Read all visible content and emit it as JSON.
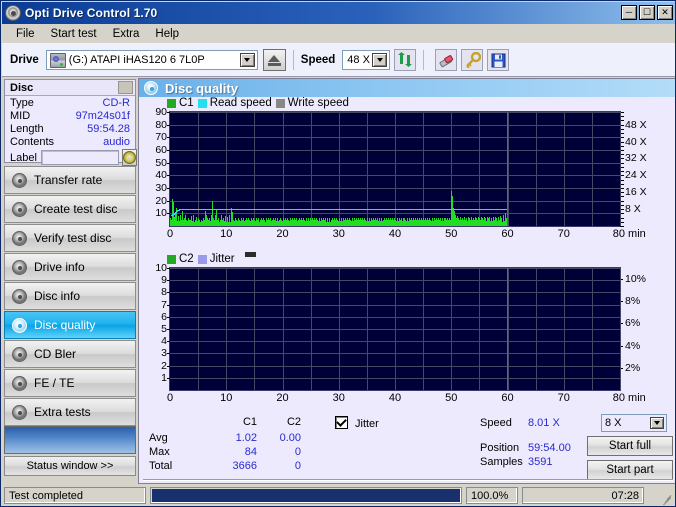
{
  "window": {
    "title": "Opti Drive Control 1.70",
    "icon": "disc-icon",
    "buttons": {
      "minimize": "_",
      "maximize": "☐",
      "close": "✕"
    }
  },
  "menu": [
    {
      "label": "File"
    },
    {
      "label": "Start test"
    },
    {
      "label": "Extra"
    },
    {
      "label": "Help"
    }
  ],
  "toolbar": {
    "drive_label": "Drive",
    "drive_value": "(G:)  ATAPI iHAS120  6 7L0P",
    "eject_icon": "eject-icon",
    "speed_label": "Speed",
    "speed_value": "48 X",
    "refresh_icon": "refresh-icon",
    "eraser_icon": "eraser-icon",
    "key_icon": "key-icon",
    "save_icon": "save-icon"
  },
  "disc": {
    "header": "Disc",
    "rows": [
      {
        "label": "Type",
        "value": "CD-R"
      },
      {
        "label": "MID",
        "value": "97m24s01f"
      },
      {
        "label": "Length",
        "value": "59:54.28"
      },
      {
        "label": "Contents",
        "value": "audio"
      }
    ],
    "label_field_label": "Label",
    "label_field_value": "",
    "label_field_placeholder": "",
    "label_button_icon": "cd-icon"
  },
  "nav": {
    "items": [
      {
        "label": "Transfer rate",
        "icon": "disc-icon",
        "active": false
      },
      {
        "label": "Create test disc",
        "icon": "disc-icon",
        "active": false
      },
      {
        "label": "Verify test disc",
        "icon": "disc-icon",
        "active": false
      },
      {
        "label": "Drive info",
        "icon": "disc-icon",
        "active": false
      },
      {
        "label": "Disc info",
        "icon": "disc-icon",
        "active": false
      },
      {
        "label": "Disc quality",
        "icon": "disc-icon",
        "active": true
      },
      {
        "label": "CD Bler",
        "icon": "disc-icon",
        "active": false
      },
      {
        "label": "FE / TE",
        "icon": "disc-icon",
        "active": false
      },
      {
        "label": "Extra tests",
        "icon": "disc-icon",
        "active": false
      }
    ],
    "status_window_button": "Status window >>"
  },
  "content": {
    "title": "Disc quality",
    "title_icon": "disc-icon"
  },
  "stats": {
    "col_headers": [
      "C1",
      "C2"
    ],
    "rows": [
      {
        "label": "Avg",
        "c1": "1.02",
        "c2": "0.00"
      },
      {
        "label": "Max",
        "c1": "84",
        "c2": "0"
      },
      {
        "label": "Total",
        "c1": "3666",
        "c2": "0"
      }
    ],
    "jitter_checkbox_label": "Jitter",
    "jitter_checked": true,
    "speed_label": "Speed",
    "speed_value": "8.01 X",
    "position_label": "Position",
    "position_value": "59:54.00",
    "samples_label": "Samples",
    "samples_value": "3591",
    "speed_select_value": "8 X",
    "start_full_button": "Start full",
    "start_part_button": "Start part"
  },
  "statusbar": {
    "message": "Test completed",
    "progress_percent": 100.0,
    "percent_text": "100.0%",
    "elapsed": "07:28"
  },
  "colors": {
    "c1": "#22dd22",
    "c2": "#22dd22",
    "read_speed": "#22e0f0",
    "write_speed": "#888888",
    "jitter": "#9a9aea",
    "plot_background": "#000038",
    "cursor": "#b432b4",
    "accent": "#2a2ad0",
    "title_bar": "#0b3c95",
    "active_nav": "#1fb2ee"
  },
  "chart_data": [
    {
      "type": "bar",
      "title": "C1 error rate / Read speed",
      "xlabel": "min",
      "ylabel": "",
      "xlim": [
        0,
        80
      ],
      "ylim": [
        0,
        90
      ],
      "y2lim": [
        0,
        54
      ],
      "grid": true,
      "legend_position": "top-left",
      "legend": [
        {
          "name": "C1",
          "color": "#22dd22"
        },
        {
          "name": "Read speed",
          "color": "#22e0f0"
        },
        {
          "name": "Write speed",
          "color": "#888888"
        }
      ],
      "xticks": [
        0,
        10,
        20,
        30,
        40,
        50,
        60,
        70,
        80
      ],
      "xtick_labels": [
        "0",
        "10",
        "20",
        "30",
        "40",
        "50",
        "60",
        "70",
        "80 min"
      ],
      "yticks": [
        10,
        20,
        30,
        40,
        50,
        60,
        70,
        80,
        90
      ],
      "ytick_labels": [
        "10",
        "20",
        "30",
        "40",
        "50",
        "60",
        "70",
        "80",
        "90"
      ],
      "y2ticks": [
        8,
        16,
        24,
        32,
        40,
        48
      ],
      "y2tick_labels": [
        "8 X",
        "16 X",
        "24 X",
        "32 X",
        "40 X",
        "48 X"
      ],
      "cursor_x": 59.9,
      "series": [
        {
          "name": "Read speed",
          "color": "#22e0f0",
          "axis": "right",
          "x": [
            0,
            0.5,
            1.0,
            2.0,
            59.9
          ],
          "values": [
            5.5,
            7.5,
            8.0,
            8.01,
            8.01
          ]
        },
        {
          "name": "C1",
          "color": "#22dd22",
          "axis": "left",
          "x_step_min": 0.333,
          "values": [
            4,
            6,
            3,
            5,
            8,
            12,
            21,
            19,
            9,
            6,
            4,
            7,
            5,
            11,
            14,
            9,
            5,
            4,
            3,
            6,
            8,
            5,
            4,
            3,
            5,
            9,
            7,
            4,
            3,
            5,
            12,
            8,
            4,
            3,
            5,
            6,
            4,
            3,
            7,
            9,
            5,
            4,
            3,
            2,
            4,
            6,
            3,
            5,
            4,
            3,
            2,
            5,
            8,
            4,
            3,
            2,
            4,
            6,
            9,
            5,
            3,
            2,
            4,
            3,
            5,
            7,
            4,
            3,
            2,
            4,
            6,
            3,
            2,
            4,
            5,
            3,
            2,
            4,
            3,
            5,
            2,
            4,
            6,
            3,
            2,
            4,
            3,
            5,
            8,
            12,
            9,
            5,
            3,
            6,
            4,
            2,
            5,
            3,
            4,
            6,
            2,
            4,
            3,
            5,
            9,
            14,
            20,
            11,
            6,
            3,
            5,
            4,
            2,
            6,
            9,
            13,
            7,
            4,
            3,
            5,
            2,
            4,
            6,
            3,
            2,
            5,
            4,
            3,
            7,
            9,
            4,
            2,
            5,
            3,
            6,
            4,
            2,
            3,
            5,
            8,
            4,
            2,
            3,
            5,
            7,
            4,
            2,
            3,
            6,
            9,
            5,
            3,
            2,
            4,
            7,
            14,
            11,
            6,
            3,
            2,
            5,
            4,
            3,
            6,
            2,
            4,
            3,
            5,
            2,
            4,
            3,
            6,
            2,
            4,
            5,
            3,
            2,
            4,
            6,
            3,
            2,
            5,
            4,
            3,
            2,
            6,
            4,
            3,
            5,
            2,
            4,
            3,
            6,
            2,
            5,
            3,
            4,
            2,
            6,
            3,
            5,
            4,
            2,
            3,
            6,
            4,
            2,
            5,
            3,
            4,
            6,
            2,
            3,
            5,
            4,
            2,
            6,
            3,
            4,
            2,
            5,
            3,
            6,
            4,
            2,
            3,
            5,
            4,
            2,
            6,
            3,
            5,
            2,
            4,
            3,
            6,
            2,
            4,
            5,
            3,
            2,
            6,
            4,
            3,
            5,
            2,
            4,
            6,
            3,
            2,
            5,
            4,
            3,
            6,
            2,
            4,
            3,
            5,
            2,
            6,
            4,
            3,
            2,
            5,
            4,
            6,
            3,
            2,
            4,
            5,
            3,
            6,
            2,
            4,
            3,
            5,
            2,
            4,
            6,
            3,
            5,
            2,
            4,
            3,
            6,
            4,
            2,
            5,
            3,
            4,
            2,
            6,
            5,
            3,
            4,
            2,
            6,
            3,
            5,
            4,
            2,
            3,
            6,
            4,
            5,
            2,
            3,
            4,
            6,
            2,
            5,
            3,
            4,
            2,
            6,
            3,
            5,
            4,
            2,
            6,
            3,
            4,
            5,
            2,
            3,
            6,
            4,
            2,
            5,
            3,
            6,
            4,
            2,
            3,
            5,
            4,
            6,
            2,
            3,
            5,
            4,
            2,
            6,
            3,
            5,
            4,
            2,
            3,
            6,
            5,
            4,
            2,
            3,
            6,
            4,
            5,
            3,
            2,
            6,
            4,
            3,
            5,
            2,
            4,
            6,
            3,
            2,
            5,
            4,
            6,
            3,
            2,
            5,
            4,
            3,
            6,
            2,
            5,
            4,
            3,
            6,
            2,
            4,
            5,
            3,
            2,
            6,
            4,
            3,
            5,
            2,
            6,
            4,
            3,
            2,
            5,
            6,
            4,
            3,
            2,
            5,
            4,
            6,
            3,
            2,
            4,
            5,
            3,
            6,
            2,
            4,
            5,
            3,
            2,
            6,
            4,
            5,
            3,
            2,
            4,
            6,
            3,
            5,
            2,
            4,
            3,
            6,
            5,
            2,
            4,
            3,
            6,
            5,
            2,
            4,
            3,
            6,
            2,
            5,
            4,
            3,
            6,
            2,
            4,
            5,
            3,
            2,
            6,
            5,
            4,
            3,
            2,
            6,
            4,
            5,
            3,
            2,
            4,
            6,
            3,
            5,
            2,
            4,
            6,
            3,
            2,
            5,
            4,
            6,
            3,
            2,
            4,
            5,
            3,
            6,
            2,
            4,
            5,
            3,
            6,
            2,
            4,
            3,
            5,
            6,
            2,
            4,
            3,
            5,
            2,
            6,
            4,
            3,
            5,
            2,
            4,
            6,
            3,
            5,
            2,
            4,
            3,
            6,
            5,
            2,
            4,
            3,
            6,
            2,
            5,
            4,
            3,
            2,
            6,
            5,
            3,
            4,
            2,
            6,
            5,
            4,
            3,
            2,
            6,
            4,
            3,
            5,
            2,
            6,
            4,
            3,
            2,
            5,
            6,
            4,
            3,
            2,
            5,
            4,
            3,
            6,
            2,
            5,
            4,
            3,
            6,
            2,
            5,
            4,
            3,
            2,
            6,
            5,
            4,
            2,
            3,
            6,
            4,
            5,
            3,
            2,
            6,
            4,
            5,
            2,
            3,
            6,
            4,
            5,
            3,
            2,
            4,
            6,
            5,
            3,
            2,
            4,
            6,
            3,
            5,
            2,
            4,
            6,
            5,
            3,
            2,
            4,
            6,
            3,
            5,
            2,
            6,
            4,
            3,
            5,
            2,
            4,
            6,
            3,
            5,
            2,
            4,
            6,
            3,
            2,
            5,
            4,
            6,
            3,
            2,
            5,
            4,
            3,
            6,
            2,
            5,
            4,
            6,
            3,
            2,
            5,
            4,
            3,
            6,
            2,
            4,
            5,
            3,
            6,
            2,
            4,
            5,
            3,
            2,
            6,
            4,
            5,
            3,
            2,
            6,
            4,
            3,
            5,
            2,
            6,
            4,
            5,
            3,
            2,
            6,
            4,
            3,
            5,
            2,
            6,
            4,
            3,
            5,
            2,
            4,
            6,
            3,
            5,
            2,
            4,
            6,
            3,
            2,
            5,
            4,
            6,
            3,
            2,
            5,
            4,
            6,
            3,
            2,
            5,
            4,
            6,
            3,
            5,
            2,
            4,
            6,
            3,
            5,
            2,
            4,
            6,
            3,
            5,
            2,
            4,
            6,
            3,
            5,
            2,
            4,
            6,
            3,
            5,
            2,
            4,
            6,
            3,
            5,
            2,
            22,
            28,
            19,
            24,
            14,
            9,
            6,
            12,
            8,
            5,
            4,
            9,
            6,
            3,
            5,
            8,
            4,
            3,
            6,
            2,
            5,
            4,
            3,
            7,
            2,
            5,
            4,
            3,
            6,
            2,
            4,
            5,
            3,
            7,
            2,
            5,
            4,
            3,
            6,
            2,
            4,
            3,
            5,
            7,
            2,
            4,
            6,
            3,
            5,
            2,
            4,
            7,
            3,
            5,
            2,
            6,
            4,
            3,
            5,
            2,
            7,
            4,
            3,
            6,
            2,
            5,
            4,
            3,
            7,
            2,
            6,
            4,
            3,
            5,
            2,
            7,
            4,
            6,
            3,
            2,
            5,
            4,
            7,
            3,
            2,
            6,
            5,
            4,
            3,
            2,
            7,
            5,
            4,
            6,
            3,
            2,
            5,
            7,
            4,
            3,
            6,
            2,
            5,
            4,
            3,
            7,
            2,
            6,
            5,
            4,
            3,
            2,
            7,
            6,
            5,
            4,
            3,
            2,
            7,
            6,
            5,
            4,
            3,
            2,
            8,
            6,
            5,
            4,
            3,
            2,
            9,
            7,
            5,
            4,
            3,
            2,
            10,
            8,
            6,
            4,
            3,
            2
          ]
        }
      ]
    },
    {
      "type": "bar",
      "title": "C2 error rate / Jitter",
      "xlabel": "min",
      "ylabel": "",
      "xlim": [
        0,
        80
      ],
      "ylim": [
        0,
        10
      ],
      "y2lim": [
        0,
        11
      ],
      "grid": true,
      "legend_position": "top-left",
      "legend": [
        {
          "name": "C2",
          "color": "#22dd22"
        },
        {
          "name": "Jitter",
          "color": "#9a9aea"
        }
      ],
      "xticks": [
        0,
        10,
        20,
        30,
        40,
        50,
        60,
        70,
        80
      ],
      "xtick_labels": [
        "0",
        "10",
        "20",
        "30",
        "40",
        "50",
        "60",
        "70",
        "80 min"
      ],
      "yticks": [
        1,
        2,
        3,
        4,
        5,
        6,
        7,
        8,
        9,
        10
      ],
      "ytick_labels": [
        "1",
        "2",
        "3",
        "4",
        "5",
        "6",
        "7",
        "8",
        "9",
        "10"
      ],
      "y2ticks": [
        2,
        4,
        6,
        8,
        10
      ],
      "y2tick_labels": [
        "2%",
        "4%",
        "6%",
        "8%",
        "10%"
      ],
      "cursor_x": 59.9,
      "series": [
        {
          "name": "C2",
          "color": "#22dd22",
          "axis": "left",
          "values": []
        },
        {
          "name": "Jitter",
          "color": "#9a9aea",
          "axis": "right",
          "values": []
        }
      ]
    }
  ]
}
